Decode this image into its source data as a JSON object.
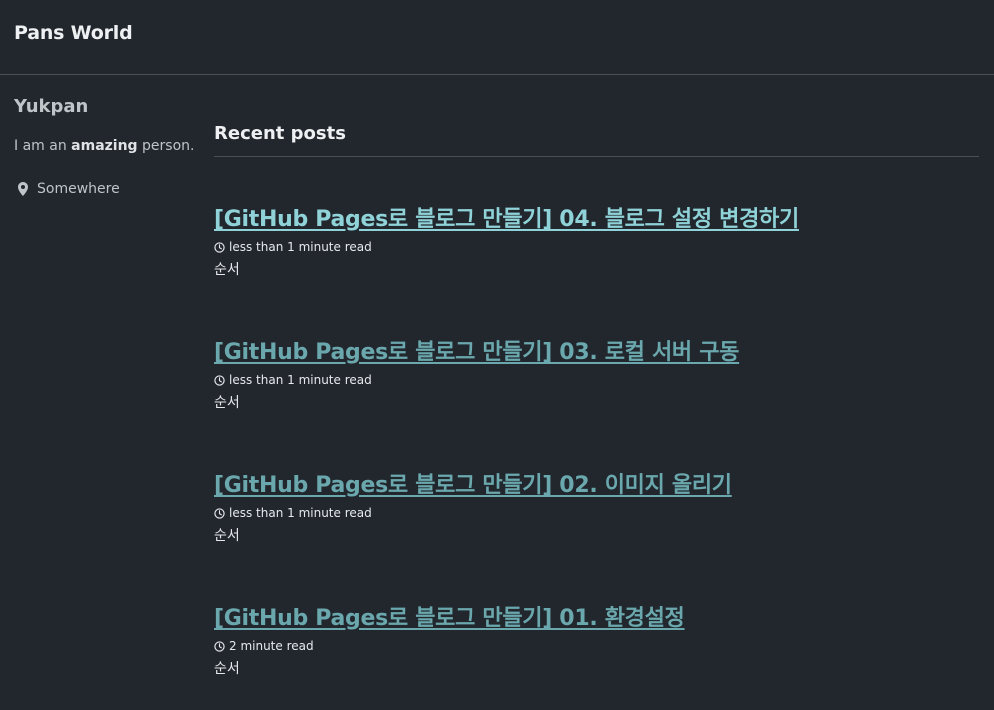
{
  "site": {
    "title": "Pans World"
  },
  "author": {
    "name": "Yukpan",
    "bio_prefix": "I am an",
    "bio_bold": "amazing",
    "bio_suffix": "person.",
    "location": "Somewhere",
    "location_icon": "map-marker-icon"
  },
  "main": {
    "section_title": "Recent posts",
    "posts": [
      {
        "title": "[GitHub Pages로 블로그 만들기] 04. 블로그 설정 변경하기",
        "read_time": "less than 1 minute read",
        "excerpt": "순서"
      },
      {
        "title": "[GitHub Pages로 블로그 만들기] 03. 로컬 서버 구동",
        "read_time": "less than 1 minute read",
        "excerpt": "순서"
      },
      {
        "title": "[GitHub Pages로 블로그 만들기] 02. 이미지 올리기",
        "read_time": "less than 1 minute read",
        "excerpt": "순서"
      },
      {
        "title": "[GitHub Pages로 블로그 만들기] 01. 환경설정",
        "read_time": "2 minute read",
        "excerpt": "순서"
      }
    ]
  },
  "colors": {
    "background": "#22272e",
    "link_active": "#8fd3d8",
    "link_visited": "#6aa8ad",
    "divider": "#4a5058"
  }
}
